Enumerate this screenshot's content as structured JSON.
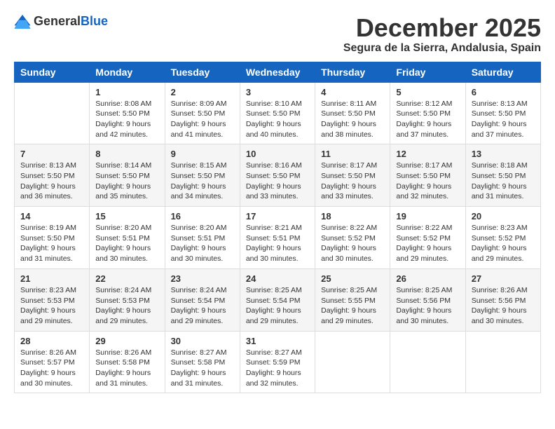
{
  "header": {
    "logo_general": "General",
    "logo_blue": "Blue",
    "month": "December 2025",
    "location": "Segura de la Sierra, Andalusia, Spain"
  },
  "days_of_week": [
    "Sunday",
    "Monday",
    "Tuesday",
    "Wednesday",
    "Thursday",
    "Friday",
    "Saturday"
  ],
  "weeks": [
    [
      {
        "day": "",
        "info": ""
      },
      {
        "day": "1",
        "info": "Sunrise: 8:08 AM\nSunset: 5:50 PM\nDaylight: 9 hours\nand 42 minutes."
      },
      {
        "day": "2",
        "info": "Sunrise: 8:09 AM\nSunset: 5:50 PM\nDaylight: 9 hours\nand 41 minutes."
      },
      {
        "day": "3",
        "info": "Sunrise: 8:10 AM\nSunset: 5:50 PM\nDaylight: 9 hours\nand 40 minutes."
      },
      {
        "day": "4",
        "info": "Sunrise: 8:11 AM\nSunset: 5:50 PM\nDaylight: 9 hours\nand 38 minutes."
      },
      {
        "day": "5",
        "info": "Sunrise: 8:12 AM\nSunset: 5:50 PM\nDaylight: 9 hours\nand 37 minutes."
      },
      {
        "day": "6",
        "info": "Sunrise: 8:13 AM\nSunset: 5:50 PM\nDaylight: 9 hours\nand 37 minutes."
      }
    ],
    [
      {
        "day": "7",
        "info": "Sunrise: 8:13 AM\nSunset: 5:50 PM\nDaylight: 9 hours\nand 36 minutes."
      },
      {
        "day": "8",
        "info": "Sunrise: 8:14 AM\nSunset: 5:50 PM\nDaylight: 9 hours\nand 35 minutes."
      },
      {
        "day": "9",
        "info": "Sunrise: 8:15 AM\nSunset: 5:50 PM\nDaylight: 9 hours\nand 34 minutes."
      },
      {
        "day": "10",
        "info": "Sunrise: 8:16 AM\nSunset: 5:50 PM\nDaylight: 9 hours\nand 33 minutes."
      },
      {
        "day": "11",
        "info": "Sunrise: 8:17 AM\nSunset: 5:50 PM\nDaylight: 9 hours\nand 33 minutes."
      },
      {
        "day": "12",
        "info": "Sunrise: 8:17 AM\nSunset: 5:50 PM\nDaylight: 9 hours\nand 32 minutes."
      },
      {
        "day": "13",
        "info": "Sunrise: 8:18 AM\nSunset: 5:50 PM\nDaylight: 9 hours\nand 31 minutes."
      }
    ],
    [
      {
        "day": "14",
        "info": "Sunrise: 8:19 AM\nSunset: 5:50 PM\nDaylight: 9 hours\nand 31 minutes."
      },
      {
        "day": "15",
        "info": "Sunrise: 8:20 AM\nSunset: 5:51 PM\nDaylight: 9 hours\nand 30 minutes."
      },
      {
        "day": "16",
        "info": "Sunrise: 8:20 AM\nSunset: 5:51 PM\nDaylight: 9 hours\nand 30 minutes."
      },
      {
        "day": "17",
        "info": "Sunrise: 8:21 AM\nSunset: 5:51 PM\nDaylight: 9 hours\nand 30 minutes."
      },
      {
        "day": "18",
        "info": "Sunrise: 8:22 AM\nSunset: 5:52 PM\nDaylight: 9 hours\nand 30 minutes."
      },
      {
        "day": "19",
        "info": "Sunrise: 8:22 AM\nSunset: 5:52 PM\nDaylight: 9 hours\nand 29 minutes."
      },
      {
        "day": "20",
        "info": "Sunrise: 8:23 AM\nSunset: 5:52 PM\nDaylight: 9 hours\nand 29 minutes."
      }
    ],
    [
      {
        "day": "21",
        "info": "Sunrise: 8:23 AM\nSunset: 5:53 PM\nDaylight: 9 hours\nand 29 minutes."
      },
      {
        "day": "22",
        "info": "Sunrise: 8:24 AM\nSunset: 5:53 PM\nDaylight: 9 hours\nand 29 minutes."
      },
      {
        "day": "23",
        "info": "Sunrise: 8:24 AM\nSunset: 5:54 PM\nDaylight: 9 hours\nand 29 minutes."
      },
      {
        "day": "24",
        "info": "Sunrise: 8:25 AM\nSunset: 5:54 PM\nDaylight: 9 hours\nand 29 minutes."
      },
      {
        "day": "25",
        "info": "Sunrise: 8:25 AM\nSunset: 5:55 PM\nDaylight: 9 hours\nand 29 minutes."
      },
      {
        "day": "26",
        "info": "Sunrise: 8:25 AM\nSunset: 5:56 PM\nDaylight: 9 hours\nand 30 minutes."
      },
      {
        "day": "27",
        "info": "Sunrise: 8:26 AM\nSunset: 5:56 PM\nDaylight: 9 hours\nand 30 minutes."
      }
    ],
    [
      {
        "day": "28",
        "info": "Sunrise: 8:26 AM\nSunset: 5:57 PM\nDaylight: 9 hours\nand 30 minutes."
      },
      {
        "day": "29",
        "info": "Sunrise: 8:26 AM\nSunset: 5:58 PM\nDaylight: 9 hours\nand 31 minutes."
      },
      {
        "day": "30",
        "info": "Sunrise: 8:27 AM\nSunset: 5:58 PM\nDaylight: 9 hours\nand 31 minutes."
      },
      {
        "day": "31",
        "info": "Sunrise: 8:27 AM\nSunset: 5:59 PM\nDaylight: 9 hours\nand 32 minutes."
      },
      {
        "day": "",
        "info": ""
      },
      {
        "day": "",
        "info": ""
      },
      {
        "day": "",
        "info": ""
      }
    ]
  ]
}
